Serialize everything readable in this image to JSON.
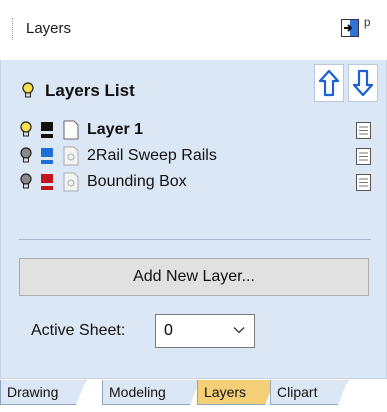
{
  "panel": {
    "title": "Layers",
    "list_title": "Layers List"
  },
  "layers": [
    {
      "label": "Layer 1",
      "color": "#111111",
      "bulb_on": true,
      "bold": true
    },
    {
      "label": "2Rail Sweep Rails",
      "color": "#1f6fd6",
      "bulb_on": false,
      "bold": false
    },
    {
      "label": "Bounding Box",
      "color": "#c0161c",
      "bulb_on": false,
      "bold": false
    }
  ],
  "buttons": {
    "add_layer": "Add New Layer..."
  },
  "active_sheet": {
    "label": "Active Sheet:",
    "value": "0"
  },
  "tabs": [
    {
      "label": "Drawing",
      "active": false
    },
    {
      "label": "Modeling",
      "active": false
    },
    {
      "label": "Layers",
      "active": true
    },
    {
      "label": "Clipart",
      "active": false
    }
  ],
  "colors": {
    "panel_bg": "#dbe7f5",
    "active_tab": "#f5cf78",
    "arrow_blue": "#1c5fd0",
    "bulb_on": "#f7e04b",
    "bulb_off": "#8a8a8a"
  }
}
